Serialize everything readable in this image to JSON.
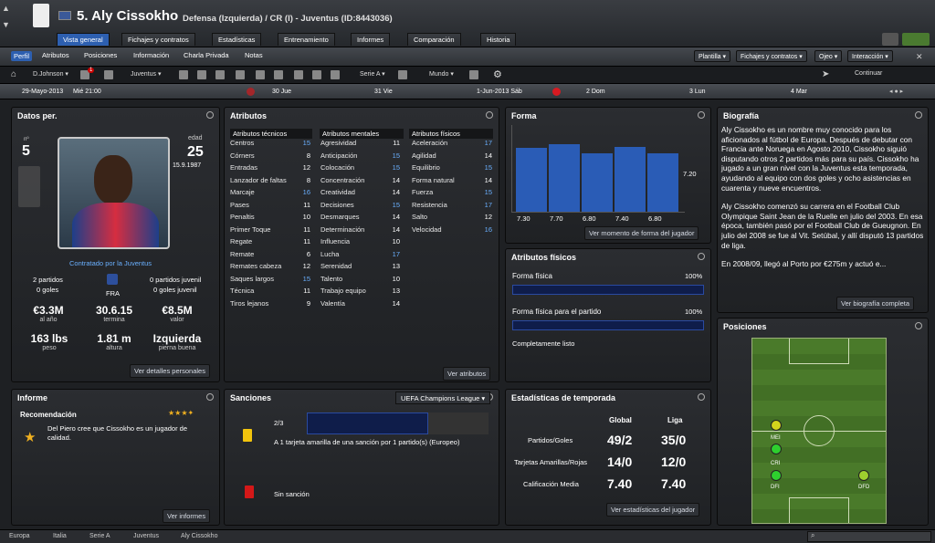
{
  "header": {
    "number_name": "5. Aly Cissokho",
    "subtitle": "Defensa (Izquierda) / CR (I) - Juventus (ID:8443036)"
  },
  "tabs": [
    "Vista general",
    "Fichajes y contratos",
    "Estadísticas",
    "Entrenamiento",
    "Informes",
    "Comparación",
    "Historia"
  ],
  "subnav": [
    "Perfil",
    "Atributos",
    "Posiciones",
    "Información",
    "Charla Privada",
    "Notas"
  ],
  "dropdowns": [
    "Plantilla",
    "Fichajes y contratos",
    "Ojeo",
    "Interacción"
  ],
  "toolbar": {
    "manager": "D.Johnson",
    "badge": "1",
    "club": "Juventus",
    "league": "Serie A",
    "world": "Mundo"
  },
  "datebar": {
    "date": "29-Mayo-2013",
    "day": "Mié 21:00",
    "d1": "30 Jue",
    "d2": "31 Vie",
    "d3": "1-Jun-2013 Sáb",
    "d4": "2 Dom",
    "d5": "3 Lun",
    "d6": "4 Mar",
    "continue": "Continuar"
  },
  "personal": {
    "title": "Datos per.",
    "no_label": "nº",
    "no": "5",
    "age_label": "edad",
    "age": "25",
    "dob": "15.9.1987",
    "contract": "Contratado por la Juventus",
    "left_apps": "2 partidos",
    "left_goals": "0 goles",
    "right_apps": "0 partidos juvenil",
    "right_goals": "0 goles juvenil",
    "nation": "FRA",
    "stats": [
      {
        "v": "€3.3M",
        "l": "al año"
      },
      {
        "v": "30.6.15",
        "l": "termina"
      },
      {
        "v": "€8.5M",
        "l": "valor"
      },
      {
        "v": "163 lbs",
        "l": "peso"
      },
      {
        "v": "1.81 m",
        "l": "altura"
      },
      {
        "v": "Izquierda",
        "l": "pierna buena"
      }
    ],
    "link": "Ver detalles personales"
  },
  "attributes": {
    "title": "Atributos",
    "tech_title": "Atributos técnicos",
    "mental_title": "Atributos mentales",
    "phys_title": "Atributos físicos",
    "tech": [
      [
        "Centros",
        "15"
      ],
      [
        "Córners",
        "8"
      ],
      [
        "Entradas",
        "12"
      ],
      [
        "Lanzador de faltas",
        "8"
      ],
      [
        "Marcaje",
        "16"
      ],
      [
        "Pases",
        "11"
      ],
      [
        "Penaltis",
        "10"
      ],
      [
        "Primer Toque",
        "11"
      ],
      [
        "Regate",
        "11"
      ],
      [
        "Remate",
        "6"
      ],
      [
        "Remates cabeza",
        "12"
      ],
      [
        "Saques largos",
        "15"
      ],
      [
        "Técnica",
        "11"
      ],
      [
        "Tiros lejanos",
        "9"
      ]
    ],
    "mental": [
      [
        "Agresividad",
        "11"
      ],
      [
        "Anticipación",
        "15"
      ],
      [
        "Colocación",
        "15"
      ],
      [
        "Concentración",
        "14"
      ],
      [
        "Creatividad",
        "14"
      ],
      [
        "Decisiones",
        "15"
      ],
      [
        "Desmarques",
        "14"
      ],
      [
        "Determinación",
        "14"
      ],
      [
        "Influencia",
        "10"
      ],
      [
        "Lucha",
        "17"
      ],
      [
        "Serenidad",
        "13"
      ],
      [
        "Talento",
        "10"
      ],
      [
        "Trabajo equipo",
        "13"
      ],
      [
        "Valentía",
        "14"
      ]
    ],
    "phys": [
      [
        "Aceleración",
        "17"
      ],
      [
        "Agilidad",
        "14"
      ],
      [
        "Equilibrio",
        "15"
      ],
      [
        "Forma natural",
        "14"
      ],
      [
        "Fuerza",
        "15"
      ],
      [
        "Resistencia",
        "17"
      ],
      [
        "Salto",
        "12"
      ],
      [
        "Velocidad",
        "16"
      ]
    ],
    "link": "Ver atributos"
  },
  "form": {
    "title": "Forma",
    "values": [
      "7.30",
      "7.70",
      "6.80",
      "7.40",
      "6.80"
    ],
    "current": "7.20",
    "link": "Ver momento de forma del jugador"
  },
  "physical": {
    "title": "Atributos físicos",
    "f1": "Forma física",
    "p1": "100%",
    "f2": "Forma física para el partido",
    "p2": "100%",
    "status": "Completamente listo"
  },
  "bio": {
    "title": "Biografía",
    "p1": "Aly Cissokho es un nombre muy conocido para los aficionados al fútbol de Europa. Después de debutar con Francia ante Noruega en Agosto 2010, Cissokho siguió disputando otros 2 partidos más para su país. Cissokho ha jugado a un gran nivel con la Juventus esta temporada, ayudando al equipo con dos goles y ocho asistencias en cuarenta y nueve encuentros.",
    "p2": "Aly Cissokho comenzó su carrera en el Football Club Olympique Saint Jean de la Ruelle en julio del 2003. En esa época, también pasó por el Football Club de Gueugnon. En julio del 2008 se fue al Vit. Setúbal, y allí disputó 13 partidos de liga.",
    "p3": "En 2008/09, llegó al Porto por €275m y actuó e...",
    "link": "Ver biografía completa"
  },
  "positions": {
    "title": "Posiciones",
    "labels": [
      "MEI",
      "CRI",
      "DFI",
      "DFD"
    ]
  },
  "report": {
    "title": "Informe",
    "rec_label": "Recomendación",
    "text": "Del Piero cree que Cissokho es un jugador de calidad.",
    "link": "Ver informes"
  },
  "sanctions": {
    "title": "Sanciones",
    "competition": "UEFA Champions League",
    "count": "2/3",
    "progress": 0.67,
    "text1": "A 1 tarjeta amarilla de una sanción por 1 partido(s) (Europeo)",
    "text2": "Sin sanción"
  },
  "season": {
    "title": "Estadísticas de temporada",
    "col1": "Global",
    "col2": "Liga",
    "rows": [
      [
        "Partidos/Goles",
        "49/2",
        "35/0"
      ],
      [
        "Tarjetas Amarillas/Rojas",
        "14/0",
        "12/0"
      ],
      [
        "Calificación Media",
        "7.40",
        "7.40"
      ]
    ],
    "link": "Ver estadísticas del jugador"
  },
  "breadcrumb": [
    "Europa",
    "Italia",
    "Serie A",
    "Juventus",
    "Aly Cissokho"
  ]
}
